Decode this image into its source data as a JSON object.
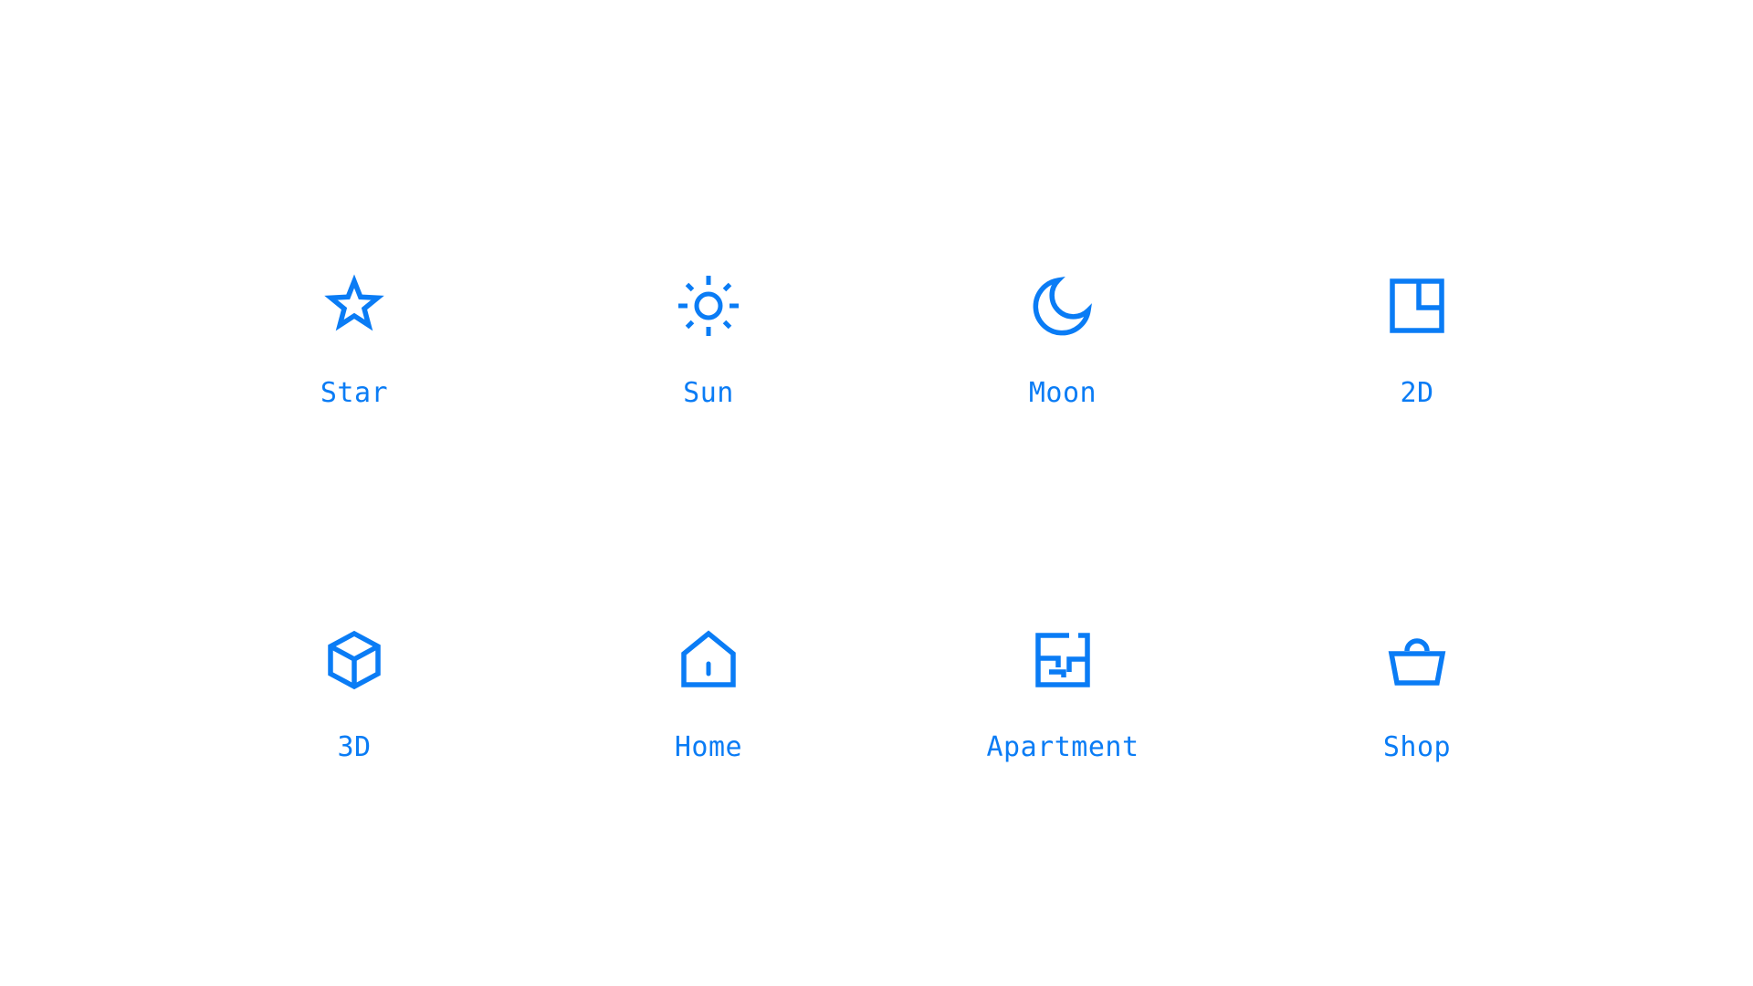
{
  "theme": {
    "accent": "#0a7cf5",
    "background": "#ffffff"
  },
  "icons": [
    {
      "label": "Star",
      "icon": "star-icon"
    },
    {
      "label": "Sun",
      "icon": "sun-icon"
    },
    {
      "label": "Moon",
      "icon": "moon-icon"
    },
    {
      "label": "2D",
      "icon": "floorplan-2d-icon"
    },
    {
      "label": "3D",
      "icon": "cube-3d-icon"
    },
    {
      "label": "Home",
      "icon": "home-icon"
    },
    {
      "label": "Apartment",
      "icon": "apartment-icon"
    },
    {
      "label": "Shop",
      "icon": "shopping-basket-icon"
    }
  ]
}
